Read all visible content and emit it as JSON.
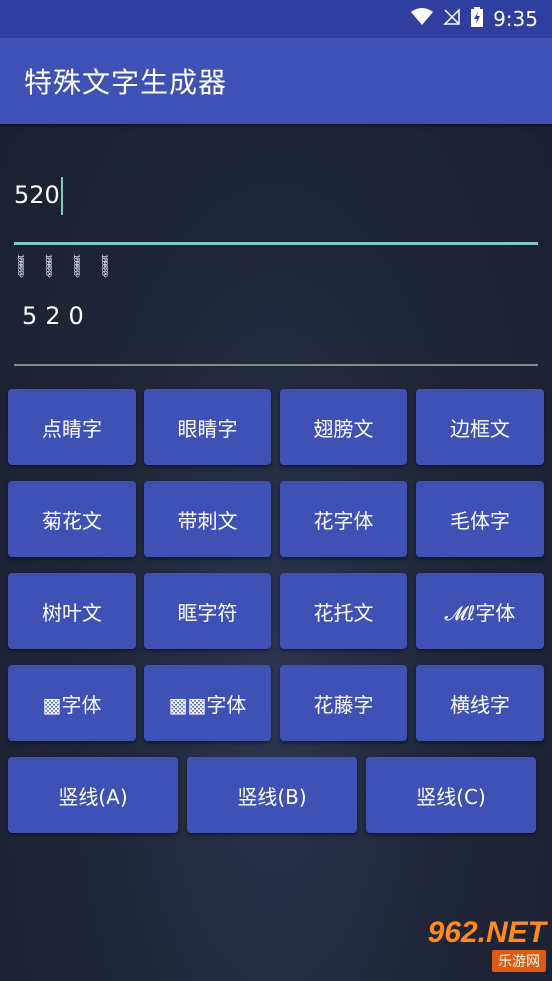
{
  "status": {
    "time": "9:35"
  },
  "app": {
    "title": "特殊文字生成器"
  },
  "input": {
    "value": "520"
  },
  "output": {
    "text": "520",
    "deco_marks": [
      "1̷ͦ0̷ͦ9̷ͦ9̷ͦ3̷ͦ3̷ͦ",
      "1̷ͦ0̷ͦ9̷ͦ9̷ͦ3̷ͦ3̷ͦ",
      "1̷ͦ0̷ͦ9̷ͦ9̷ͦ3̷ͦ3̷ͦ",
      "1̷ͦ0̷ͦ9̷ͦ9̷ͦ3̷ͦ3̷ͦ"
    ]
  },
  "buttons": {
    "row1": [
      "点睛字",
      "眼睛字",
      "翅膀文",
      "边框文"
    ],
    "row2": [
      "菊花文",
      "带刺文",
      "花字体",
      "毛体字"
    ],
    "row3": [
      "树叶文",
      "眶字符",
      "花托文",
      "𝓜ℓ字体"
    ],
    "row4": [
      "▩字体",
      "▩▩字体",
      "花藤字",
      "横线字"
    ],
    "row5": [
      "竖线(A)",
      "竖线(B)",
      "竖线(C)"
    ]
  },
  "watermark": {
    "logo": "962.NET",
    "sub": "乐游网"
  },
  "icons": {
    "wifi": "wifi-icon",
    "signal": "no-signal-icon",
    "battery": "battery-charging-icon"
  },
  "colors": {
    "primary": "#3f51b5",
    "primary_dark": "#303f9f",
    "accent": "#80cbc4"
  }
}
